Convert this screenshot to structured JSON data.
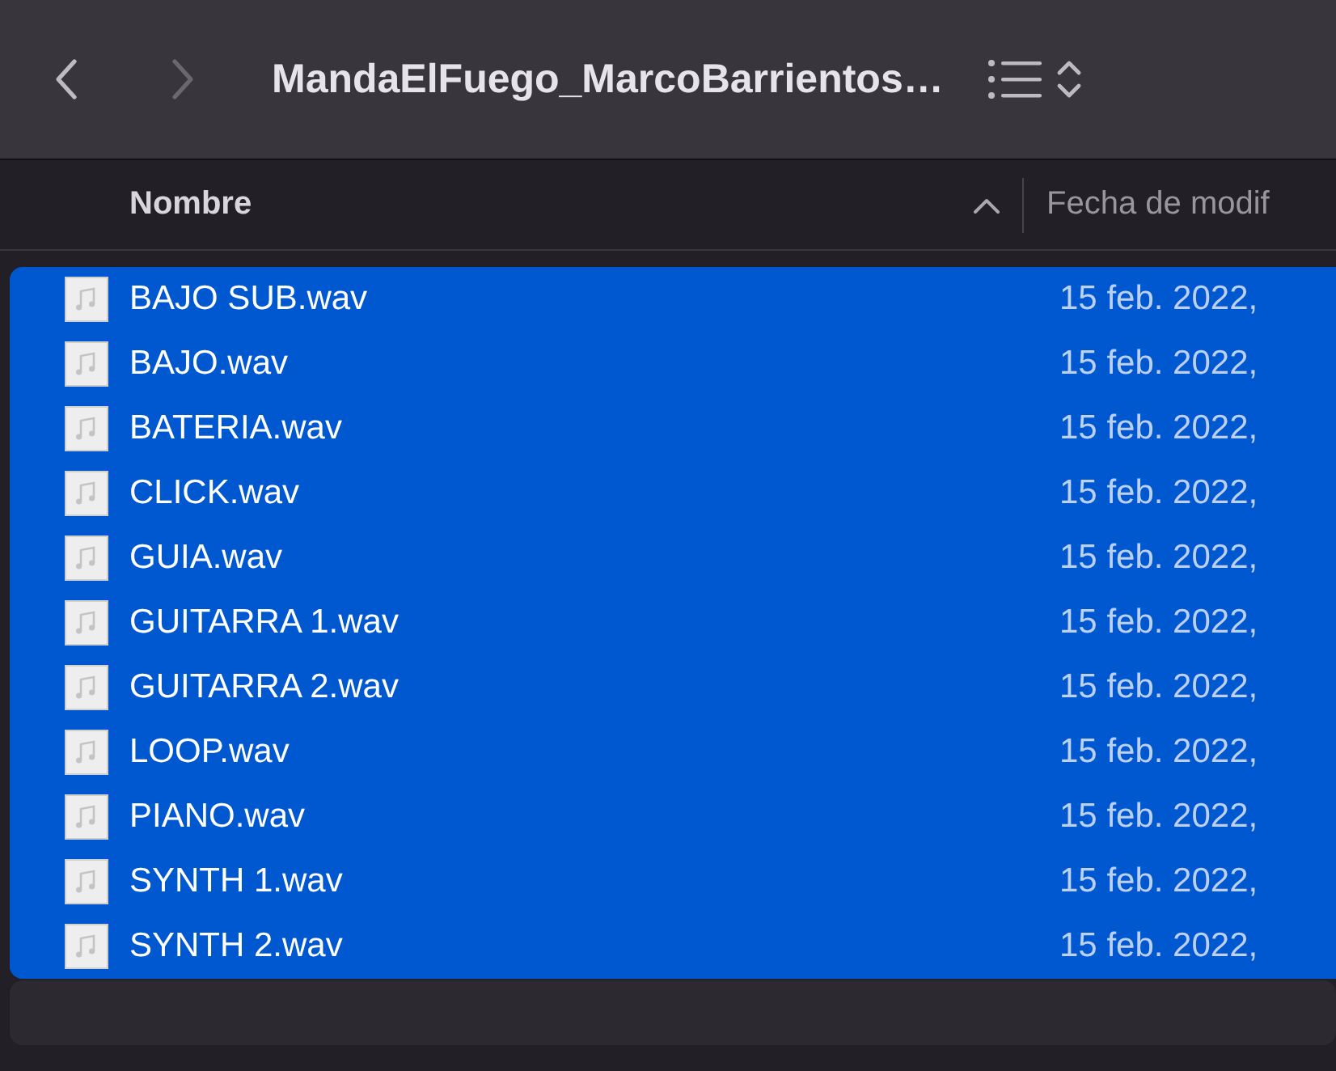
{
  "window": {
    "title": "MandaElFuego_MarcoBarrientos…"
  },
  "toolbar": {
    "back_enabled": true,
    "forward_enabled": false
  },
  "table": {
    "columns": [
      {
        "label": "Nombre",
        "sorted": true
      },
      {
        "label": "Fecha de modif",
        "sorted": false
      }
    ],
    "rows": [
      {
        "name": "BAJO SUB.wav",
        "date": "15 feb. 2022,",
        "selected": true
      },
      {
        "name": "BAJO.wav",
        "date": "15 feb. 2022,",
        "selected": true
      },
      {
        "name": "BATERIA.wav",
        "date": "15 feb. 2022,",
        "selected": true
      },
      {
        "name": "CLICK.wav",
        "date": "15 feb. 2022,",
        "selected": true
      },
      {
        "name": "GUIA.wav",
        "date": "15 feb. 2022,",
        "selected": true
      },
      {
        "name": "GUITARRA 1.wav",
        "date": "15 feb. 2022,",
        "selected": true
      },
      {
        "name": "GUITARRA 2.wav",
        "date": "15 feb. 2022,",
        "selected": true
      },
      {
        "name": "LOOP.wav",
        "date": "15 feb. 2022,",
        "selected": true
      },
      {
        "name": "PIANO.wav",
        "date": "15 feb. 2022,",
        "selected": true
      },
      {
        "name": "SYNTH 1.wav",
        "date": "15 feb. 2022,",
        "selected": true
      },
      {
        "name": "SYNTH 2.wav",
        "date": "15 feb. 2022,",
        "selected": true
      }
    ]
  }
}
